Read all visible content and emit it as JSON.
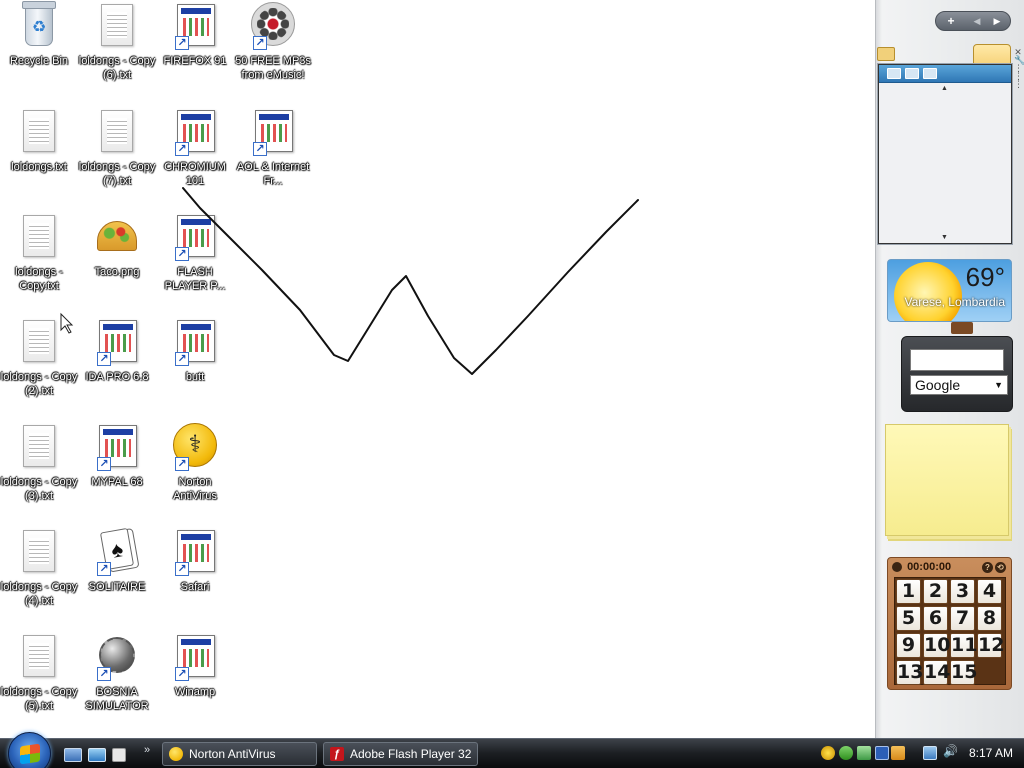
{
  "desktop_icons": [
    {
      "label": "Recycle Bin",
      "type": "recycle-bin"
    },
    {
      "label": "loldongs - Copy (6).txt",
      "type": "text-document"
    },
    {
      "label": "FIREFOX 91",
      "type": "application-shortcut"
    },
    {
      "label": "50 FREE MP3s from eMusic!",
      "type": "media-shortcut"
    },
    {
      "label": "loldongs.txt",
      "type": "text-document"
    },
    {
      "label": "loldongs - Copy (7).txt",
      "type": "text-document"
    },
    {
      "label": "CHROMIUM 101",
      "type": "application-shortcut"
    },
    {
      "label": "AOL & Internet Fr...",
      "type": "application-shortcut"
    },
    {
      "label": "loldongs - Copy.txt",
      "type": "text-document"
    },
    {
      "label": "Taco.png",
      "type": "image"
    },
    {
      "label": "FLASH PLAYER P...",
      "type": "application-shortcut"
    },
    {
      "label": "loldongs - Copy (2).txt",
      "type": "text-document"
    },
    {
      "label": "IDA PRO 6.8",
      "type": "application-shortcut"
    },
    {
      "label": "butt",
      "type": "application-shortcut"
    },
    {
      "label": "loldongs - Copy (3).txt",
      "type": "text-document"
    },
    {
      "label": "MYPAL 68",
      "type": "application-shortcut"
    },
    {
      "label": "Norton AntiVirus",
      "type": "antivirus-shortcut"
    },
    {
      "label": "loldongs - Copy (4).txt",
      "type": "text-document"
    },
    {
      "label": "SOLITAIRE",
      "type": "cards-shortcut"
    },
    {
      "label": "Safari",
      "type": "application-shortcut"
    },
    {
      "label": "loldongs - Copy (5).txt",
      "type": "text-document"
    },
    {
      "label": "BOSNIA SIMULATOR",
      "type": "mine-shortcut"
    },
    {
      "label": "Winamp",
      "type": "application-shortcut"
    }
  ],
  "sidebar": {
    "controls": {
      "add": "+",
      "prev": "◀",
      "next": "▶"
    },
    "weather": {
      "temperature": "69°",
      "location": "Varese, Lombardia"
    },
    "search": {
      "query": "",
      "engine": "Google"
    },
    "notes": {
      "text": ""
    },
    "puzzle": {
      "timer": "00:00:00",
      "tiles": [
        "1",
        "2",
        "3",
        "4",
        "5",
        "6",
        "7",
        "8",
        "9",
        "10",
        "11",
        "12",
        "13",
        "14",
        "15",
        ""
      ]
    }
  },
  "taskbar": {
    "tasks": [
      {
        "label": "Norton AntiVirus",
        "icon": "norton-icon"
      },
      {
        "label": "Adobe Flash Player 32",
        "icon": "flash-icon"
      }
    ],
    "clock": "8:17 AM"
  },
  "colors": {
    "taskbar": "#1c1f23",
    "desktop": "#ffffff",
    "note": "#fff9b8",
    "puzzle": "#a9683a"
  }
}
